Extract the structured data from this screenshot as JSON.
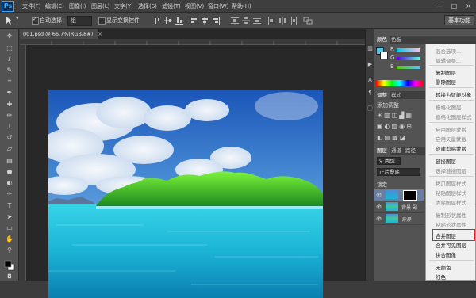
{
  "app": {
    "logo": "Ps"
  },
  "menu": [
    "文件(F)",
    "编辑(E)",
    "图像(I)",
    "图层(L)",
    "文字(Y)",
    "选择(S)",
    "滤镜(T)",
    "视图(V)",
    "窗口(W)",
    "帮助(H)"
  ],
  "window_controls": [
    "—",
    "□",
    "×"
  ],
  "options": {
    "auto_select_label": "自动选择：",
    "auto_select_value": "组",
    "show_transform_label": "显示变换控件",
    "workspace": "基本功能"
  },
  "document": {
    "tab_title": "001.psd @ 66.7%(RGB/8#)",
    "tab_close": "×"
  },
  "panels": {
    "color_tabs": [
      "颜色",
      "色板"
    ],
    "rgb_labels": [
      "R",
      "G",
      "B"
    ],
    "adjust_tabs": [
      "调整",
      "样式"
    ],
    "adjust_add_label": "添加调整",
    "layers_tabs": [
      "图层",
      "通道",
      "路径"
    ],
    "kind_label": "类型",
    "blend_mode": "正片叠底",
    "lock_label": "锁定",
    "layers": [
      {
        "name": ""
      },
      {
        "name": "背景 副"
      },
      {
        "name": "背景"
      }
    ],
    "colors": {
      "foreground": "#58c4e6",
      "background": "#ffffff"
    }
  },
  "context_menu": {
    "items": [
      {
        "label": "混合选项...",
        "enabled": false
      },
      {
        "label": "编辑调整...",
        "enabled": false
      },
      {
        "label": "复制图层",
        "enabled": true
      },
      {
        "label": "删除图层",
        "enabled": true
      },
      {
        "label": "转换为智能对象",
        "enabled": true
      },
      {
        "label": "栅格化图层",
        "enabled": false
      },
      {
        "label": "栅格化图层样式",
        "enabled": false
      },
      {
        "label": "启用图层蒙版",
        "enabled": false
      },
      {
        "label": "启用矢量蒙版",
        "enabled": false
      },
      {
        "label": "创建剪贴蒙版",
        "enabled": true
      },
      {
        "label": "链接图层",
        "enabled": true
      },
      {
        "label": "选择链接图层",
        "enabled": false
      },
      {
        "label": "拷贝图层样式",
        "enabled": false
      },
      {
        "label": "粘贴图层样式",
        "enabled": false
      },
      {
        "label": "清除图层样式",
        "enabled": false
      },
      {
        "label": "复制形状属性",
        "enabled": false
      },
      {
        "label": "粘贴形状属性",
        "enabled": false
      },
      {
        "label": "合并图层",
        "enabled": true,
        "highlighted": true
      },
      {
        "label": "合并可见图层",
        "enabled": true
      },
      {
        "label": "拼合图像",
        "enabled": true
      },
      {
        "label": "无颜色",
        "enabled": true
      },
      {
        "label": "红色",
        "enabled": true
      }
    ],
    "highlight_color": "#e02020"
  }
}
